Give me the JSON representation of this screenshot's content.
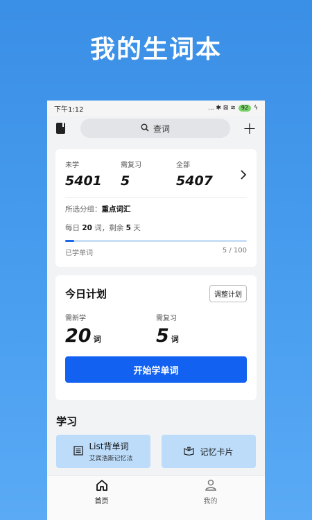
{
  "promo": {
    "title": "我的生词本"
  },
  "status": {
    "time": "下午1:12",
    "icons": "... ✱ ⊠ ≋",
    "battery": "92"
  },
  "search": {
    "label": "查词"
  },
  "overview": {
    "stats": [
      {
        "label": "未学",
        "value": "5401"
      },
      {
        "label": "需复习",
        "value": "5"
      },
      {
        "label": "全部",
        "value": "5407"
      }
    ],
    "group_prefix": "所选分组：",
    "group_name": "重点词汇",
    "daily_prefix": "每日 ",
    "daily_count": "20",
    "daily_mid": " 词，剩余 ",
    "days_left": "5",
    "daily_suffix": " 天",
    "progress_label": "已学单词",
    "progress_text": "5 / 100",
    "progress_fraction": 0.05
  },
  "plan": {
    "title": "今日计划",
    "adjust_label": "调整计划",
    "new_label": "需新学",
    "new_count": "20",
    "review_label": "需复习",
    "review_count": "5",
    "unit": "词",
    "start_label": "开始学单词"
  },
  "study": {
    "title": "学习",
    "list_title": "List背单词",
    "list_sub": "艾宾浩斯记忆法",
    "cards_title": "记忆卡片"
  },
  "tabs": [
    {
      "label": "首页",
      "icon": "home-icon",
      "active": true
    },
    {
      "label": "我的",
      "icon": "user-icon",
      "active": false
    }
  ],
  "colors": {
    "accent": "#1261f0",
    "study_button": "#bcdcfa"
  }
}
